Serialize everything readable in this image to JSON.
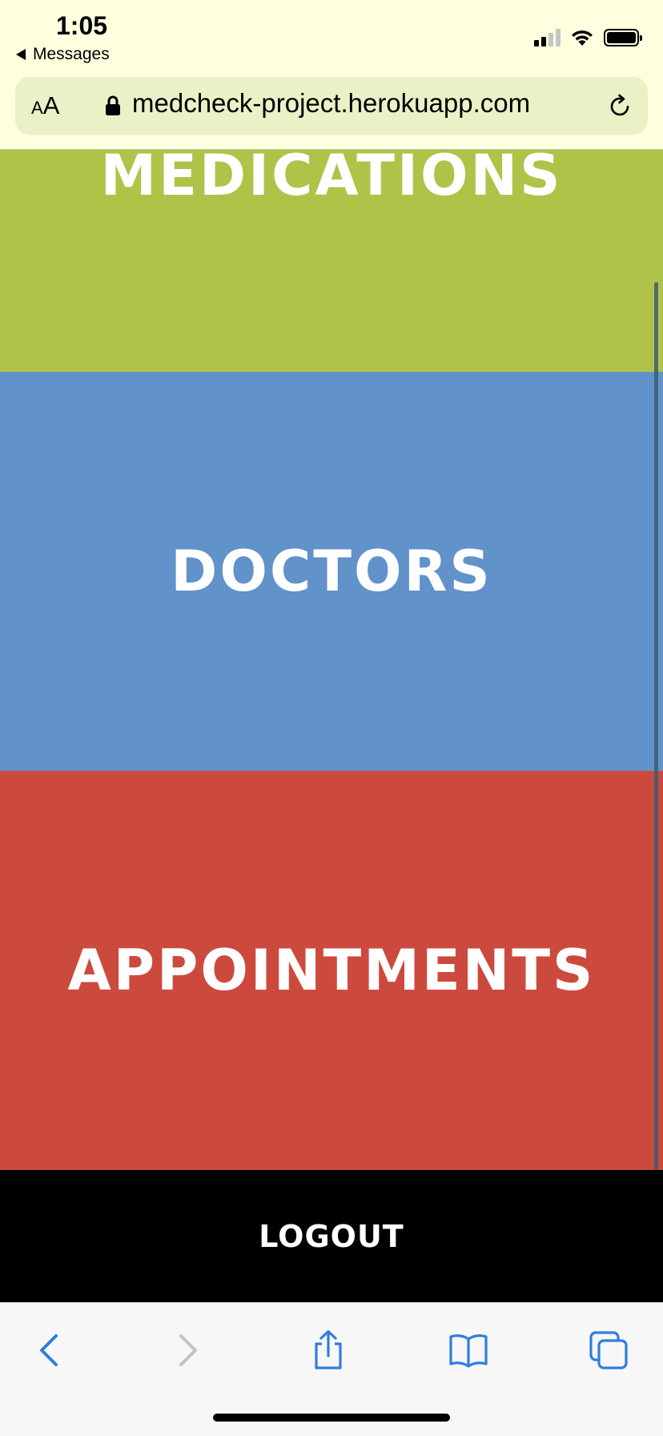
{
  "status_bar": {
    "time": "1:05",
    "back_app_label": "Messages"
  },
  "browser": {
    "text_size_small": "A",
    "text_size_big": "A",
    "url": "medcheck-project.herokuapp.com"
  },
  "page": {
    "tiles": [
      {
        "label": "MEDICATIONS",
        "color": "#afc349"
      },
      {
        "label": "DOCTORS",
        "color": "#6192c9"
      },
      {
        "label": "APPOINTMENTS",
        "color": "#cc4a3d"
      }
    ],
    "logout_label": "LOGOUT"
  },
  "toolbar": {
    "icons": [
      "back-icon",
      "forward-icon",
      "share-icon",
      "bookmarks-icon",
      "tabs-icon"
    ],
    "accent_color": "#2f7de1",
    "disabled_color": "#c2c2c2"
  }
}
